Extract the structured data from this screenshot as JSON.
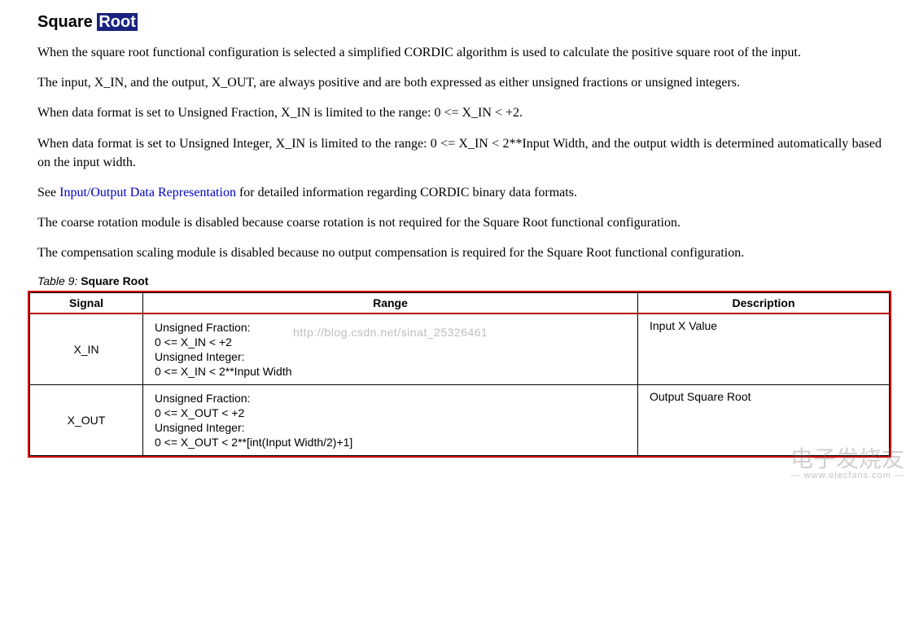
{
  "heading": {
    "plain": "Square ",
    "highlighted": "Root"
  },
  "paragraphs": {
    "p1": "When the square root functional configuration is selected a simplified CORDIC algorithm is used to calculate the positive square root of the input.",
    "p2": "The input, X_IN, and the output, X_OUT, are always positive and are both expressed as either unsigned fractions or unsigned integers.",
    "p3": "When data format is set to Unsigned Fraction, X_IN is limited to the range: 0 <= X_IN < +2.",
    "p4": "When data format is set to Unsigned Integer, X_IN is limited to the range: 0 <= X_IN < 2**Input Width, and the output width is determined automatically based on the input width.",
    "p5_pre": "See ",
    "p5_link": "Input/Output Data Representation",
    "p5_post": " for detailed information regarding CORDIC binary data formats.",
    "p6": "The coarse rotation module is disabled because coarse rotation is not required for the Square Root functional configuration.",
    "p7": "The compensation scaling module is disabled because no output compensation is required for the Square Root functional configuration."
  },
  "watermark_url": "http://blog.csdn.net/sinat_25326461",
  "table": {
    "caption_word": "Table",
    "caption_num": "9:",
    "caption_name": "Square Root",
    "headers": {
      "signal": "Signal",
      "range": "Range",
      "description": "Description"
    },
    "rows": [
      {
        "signal": "X_IN",
        "range": [
          "Unsigned Fraction:",
          "0 <= X_IN < +2",
          "Unsigned Integer:",
          "0 <= X_IN < 2**Input Width"
        ],
        "description": "Input X Value"
      },
      {
        "signal": "X_OUT",
        "range": [
          "Unsigned Fraction:",
          "0 <= X_OUT < +2",
          "Unsigned Integer:",
          "0 <= X_OUT < 2**[int(Input Width/2)+1]"
        ],
        "description": "Output Square Root"
      }
    ]
  },
  "corner_watermark": {
    "line1": "电子发烧友",
    "line2": "— www.elecfans.com —"
  }
}
